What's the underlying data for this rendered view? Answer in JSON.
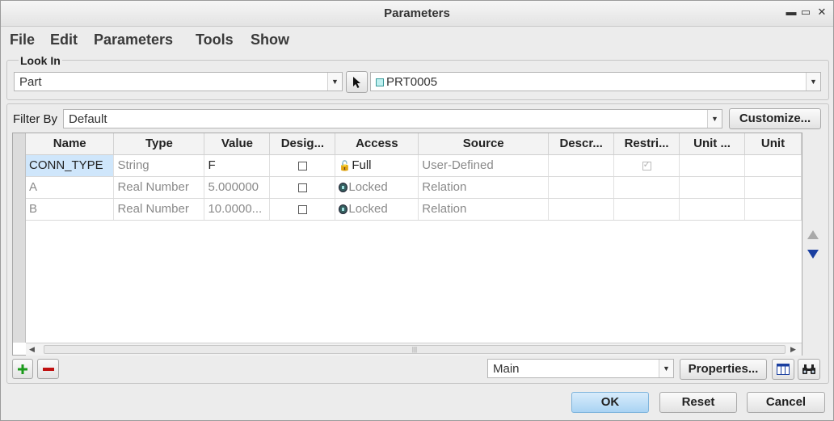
{
  "window": {
    "title": "Parameters",
    "controls": [
      "▬",
      "▭",
      "✕"
    ]
  },
  "menu": [
    "File",
    "Edit",
    "Parameters",
    "Tools",
    "Show"
  ],
  "look_in": {
    "label": "Look In",
    "type_value": "Part",
    "model_value": "PRT0005"
  },
  "filter": {
    "label": "Filter By",
    "value": "Default",
    "customize_label": "Customize..."
  },
  "table": {
    "columns": [
      "Name",
      "Type",
      "Value",
      "Desig...",
      "Access",
      "Source",
      "Descr...",
      "Restri...",
      "Unit ...",
      "Unit"
    ],
    "rows": [
      {
        "name": "CONN_TYPE",
        "type": "String",
        "value": "F",
        "designate": false,
        "access": "Full",
        "source": "User-Defined",
        "restricted": true
      },
      {
        "name": "A",
        "type": "Real Number",
        "value": "5.000000",
        "designate": false,
        "access": "Locked",
        "source": "Relation",
        "restricted": false
      },
      {
        "name": "B",
        "type": "Real Number",
        "value": "10.0000...",
        "designate": false,
        "access": "Locked",
        "source": "Relation",
        "restricted": false
      }
    ]
  },
  "bottom": {
    "view_value": "Main",
    "properties_label": "Properties..."
  },
  "footer": {
    "ok_label": "OK",
    "reset_label": "Reset",
    "cancel_label": "Cancel"
  },
  "colors": {
    "accent": "#a9d3f3",
    "selection": "#cfe6fb",
    "add": "#1a9a1a",
    "remove": "#c01010",
    "arrow_down": "#1a3fa0"
  }
}
